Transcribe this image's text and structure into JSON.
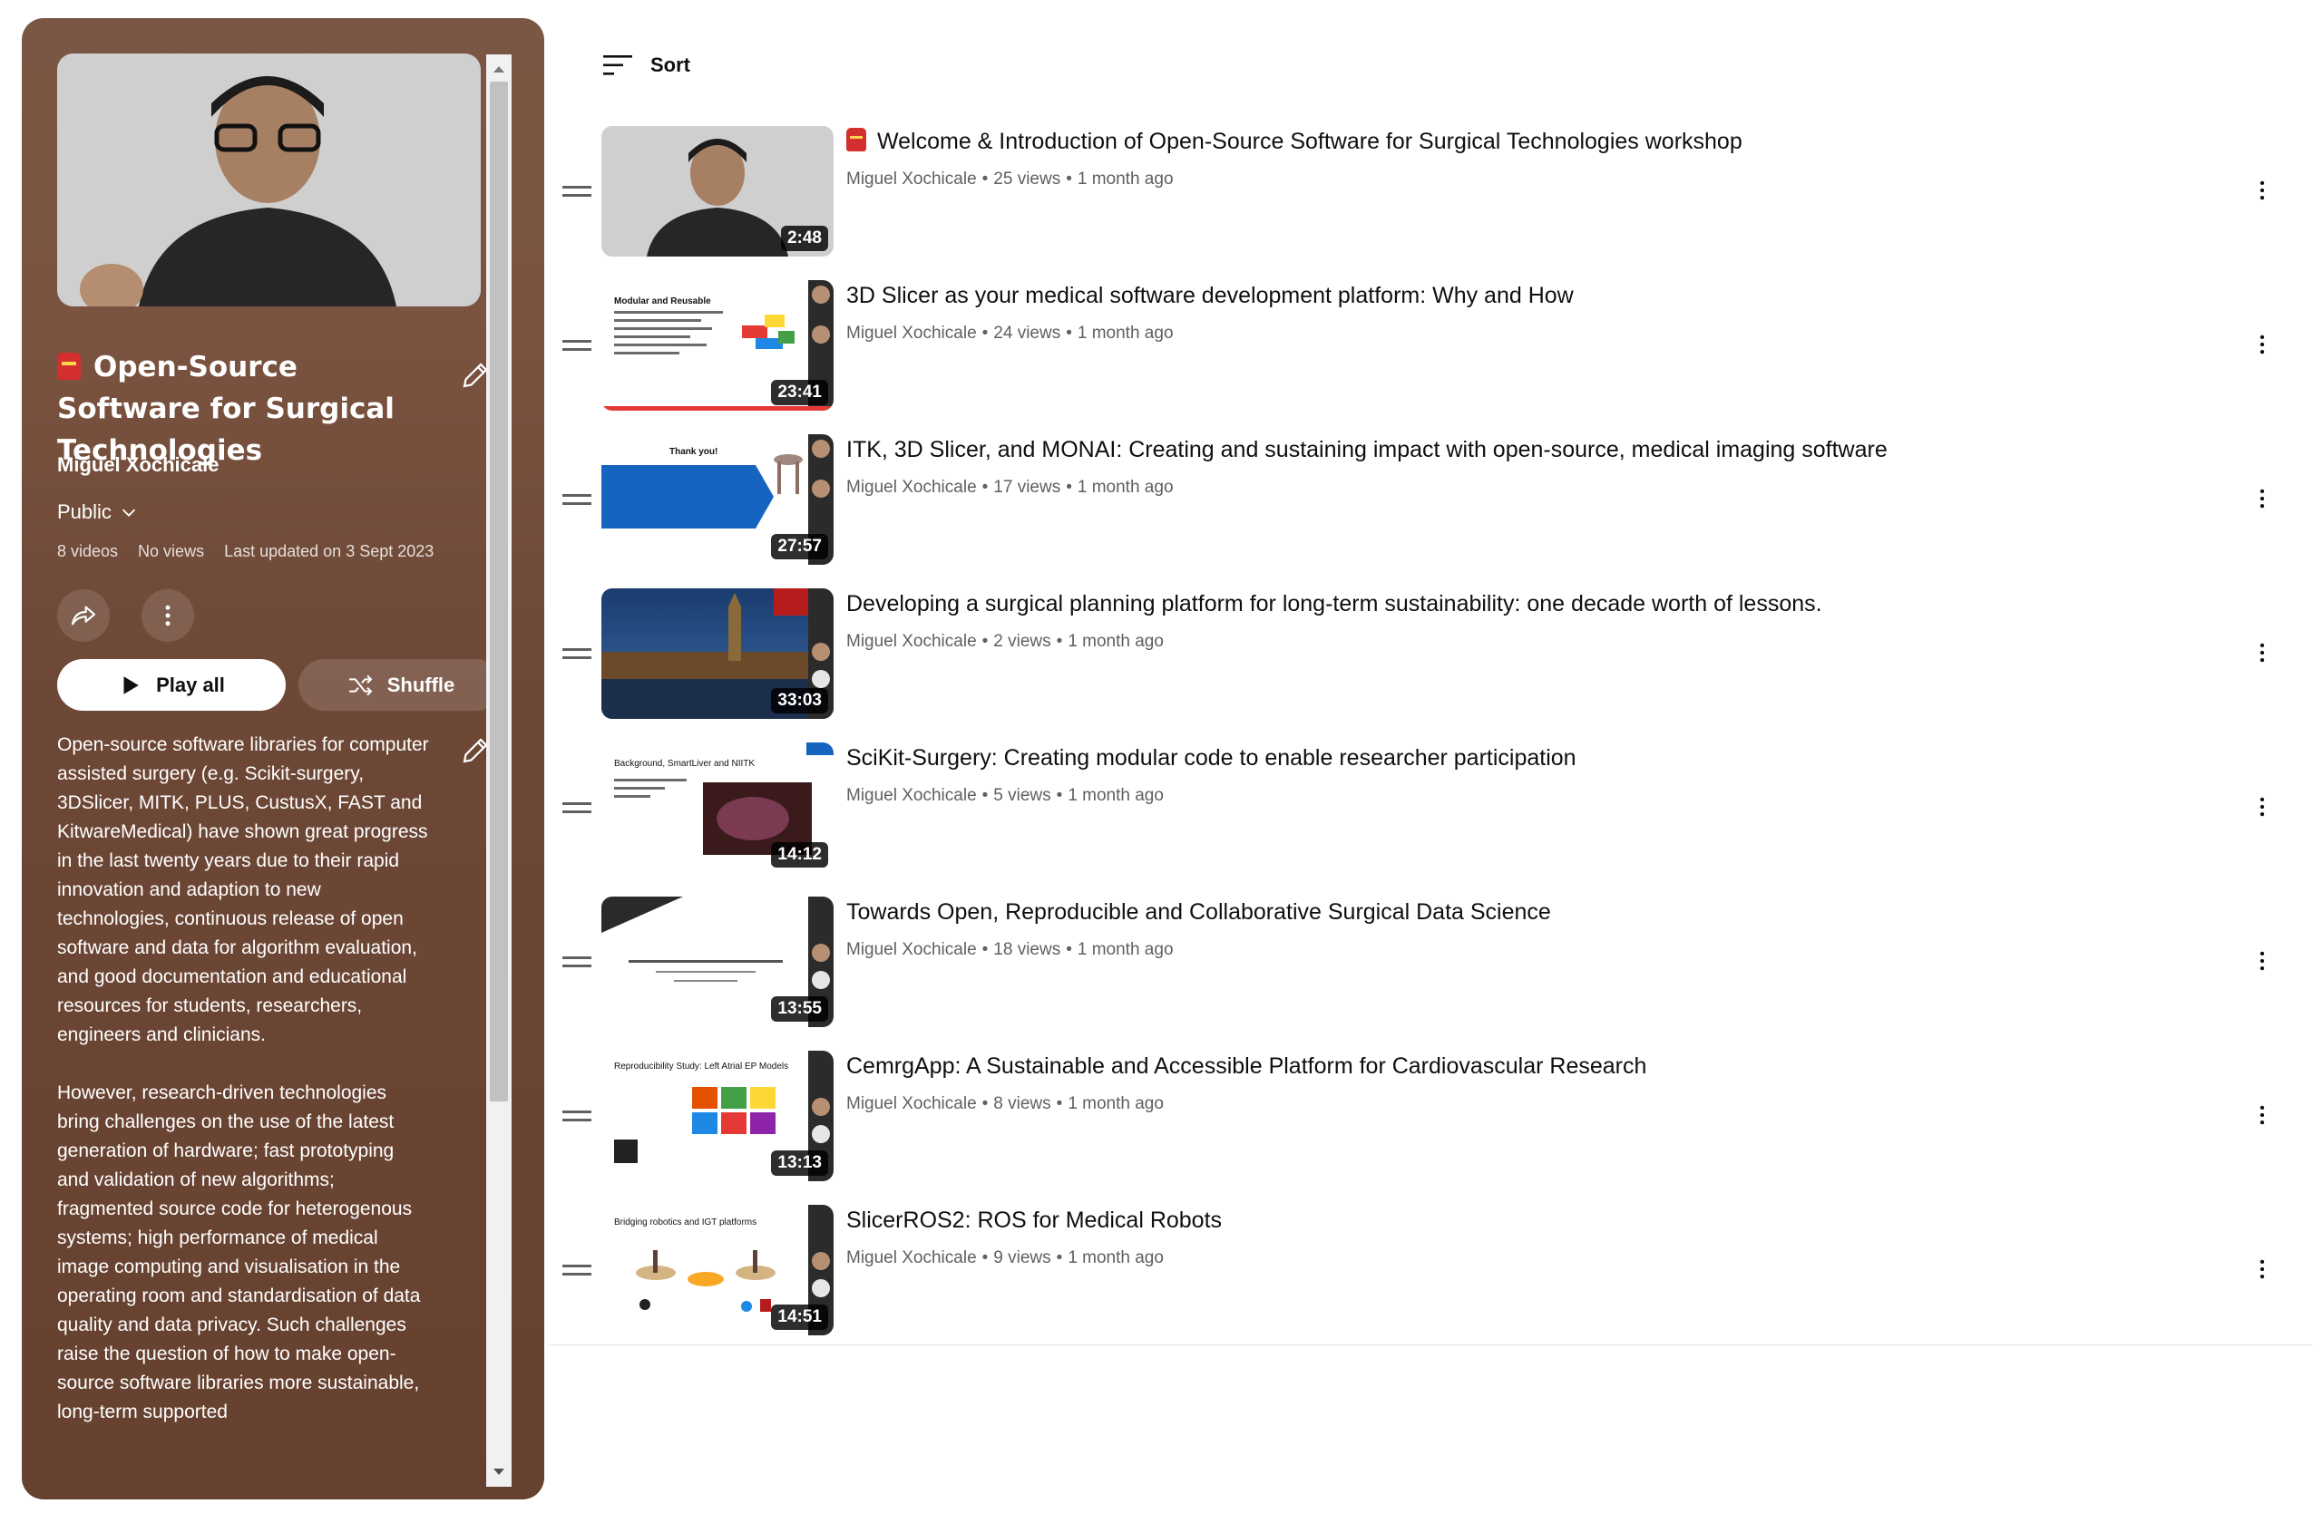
{
  "playlist": {
    "title": "Open-Source Software for Surgical Technologies",
    "owner": "Miguel Xochicale",
    "privacy": "Public",
    "video_count": "8 videos",
    "views": "No views",
    "last_updated": "Last updated on 3 Sept 2023",
    "play_all_label": "Play all",
    "shuffle_label": "Shuffle",
    "description": "Open-source software libraries for computer assisted surgery (e.g. Scikit-surgery, 3DSlicer, MITK, PLUS, CustusX, FAST and KitwareMedical) have shown great progress in the last twenty years due to their rapid innovation and adaption to new technologies, continuous release of open software and data for algorithm evaluation, and good documentation and educational resources for students, researchers, engineers and clinicians.\n\nHowever, research-driven technologies bring challenges on the use of the latest generation of hardware; fast prototyping and validation of new algorithms; fragmented source code for heterogenous systems; high performance of medical image computing and visualisation in the operating room and standardisation of data quality and data privacy. Such challenges raise the question of how to make open-source software libraries more sustainable, long-term supported"
  },
  "sort_label": "Sort",
  "videos": [
    {
      "title": "Welcome & Introduction of Open-Source Software for Surgical Technologies workshop",
      "channel": "Miguel Xochicale",
      "views": "25 views",
      "age": "1 month ago",
      "duration": "2:48"
    },
    {
      "title": "3D Slicer as your medical software development platform: Why and How",
      "channel": "Miguel Xochicale",
      "views": "24 views",
      "age": "1 month ago",
      "duration": "23:41"
    },
    {
      "title": "ITK, 3D Slicer, and MONAI: Creating and sustaining impact with open-source, medical imaging software",
      "channel": "Miguel Xochicale",
      "views": "17 views",
      "age": "1 month ago",
      "duration": "27:57"
    },
    {
      "title": "Developing a surgical planning platform for long-term sustainability: one decade worth of lessons.",
      "channel": "Miguel Xochicale",
      "views": "2 views",
      "age": "1 month ago",
      "duration": "33:03"
    },
    {
      "title": "SciKit-Surgery: Creating modular code to enable researcher participation",
      "channel": "Miguel Xochicale",
      "views": "5 views",
      "age": "1 month ago",
      "duration": "14:12"
    },
    {
      "title": "Towards Open, Reproducible and Collaborative Surgical Data Science",
      "channel": "Miguel Xochicale",
      "views": "18 views",
      "age": "1 month ago",
      "duration": "13:55"
    },
    {
      "title": "CemrgApp: A Sustainable and Accessible Platform for Cardiovascular Research",
      "channel": "Miguel Xochicale",
      "views": "8 views",
      "age": "1 month ago",
      "duration": "13:13"
    },
    {
      "title": "SlicerROS2: ROS for Medical Robots",
      "channel": "Miguel Xochicale",
      "views": "9 views",
      "age": "1 month ago",
      "duration": "14:51"
    }
  ],
  "thumb_slides": {
    "v2_title": "Modular and Reusable",
    "v3_title": "Thank you!",
    "v5_title": "Background, SmartLiver and NIITK",
    "v7_title": "Reproducibility Study: Left Atrial EP Models",
    "v8_title": "Bridging robotics and IGT platforms"
  },
  "colors": {
    "panel": "#6e4837",
    "accent_red": "#d32f2f"
  }
}
